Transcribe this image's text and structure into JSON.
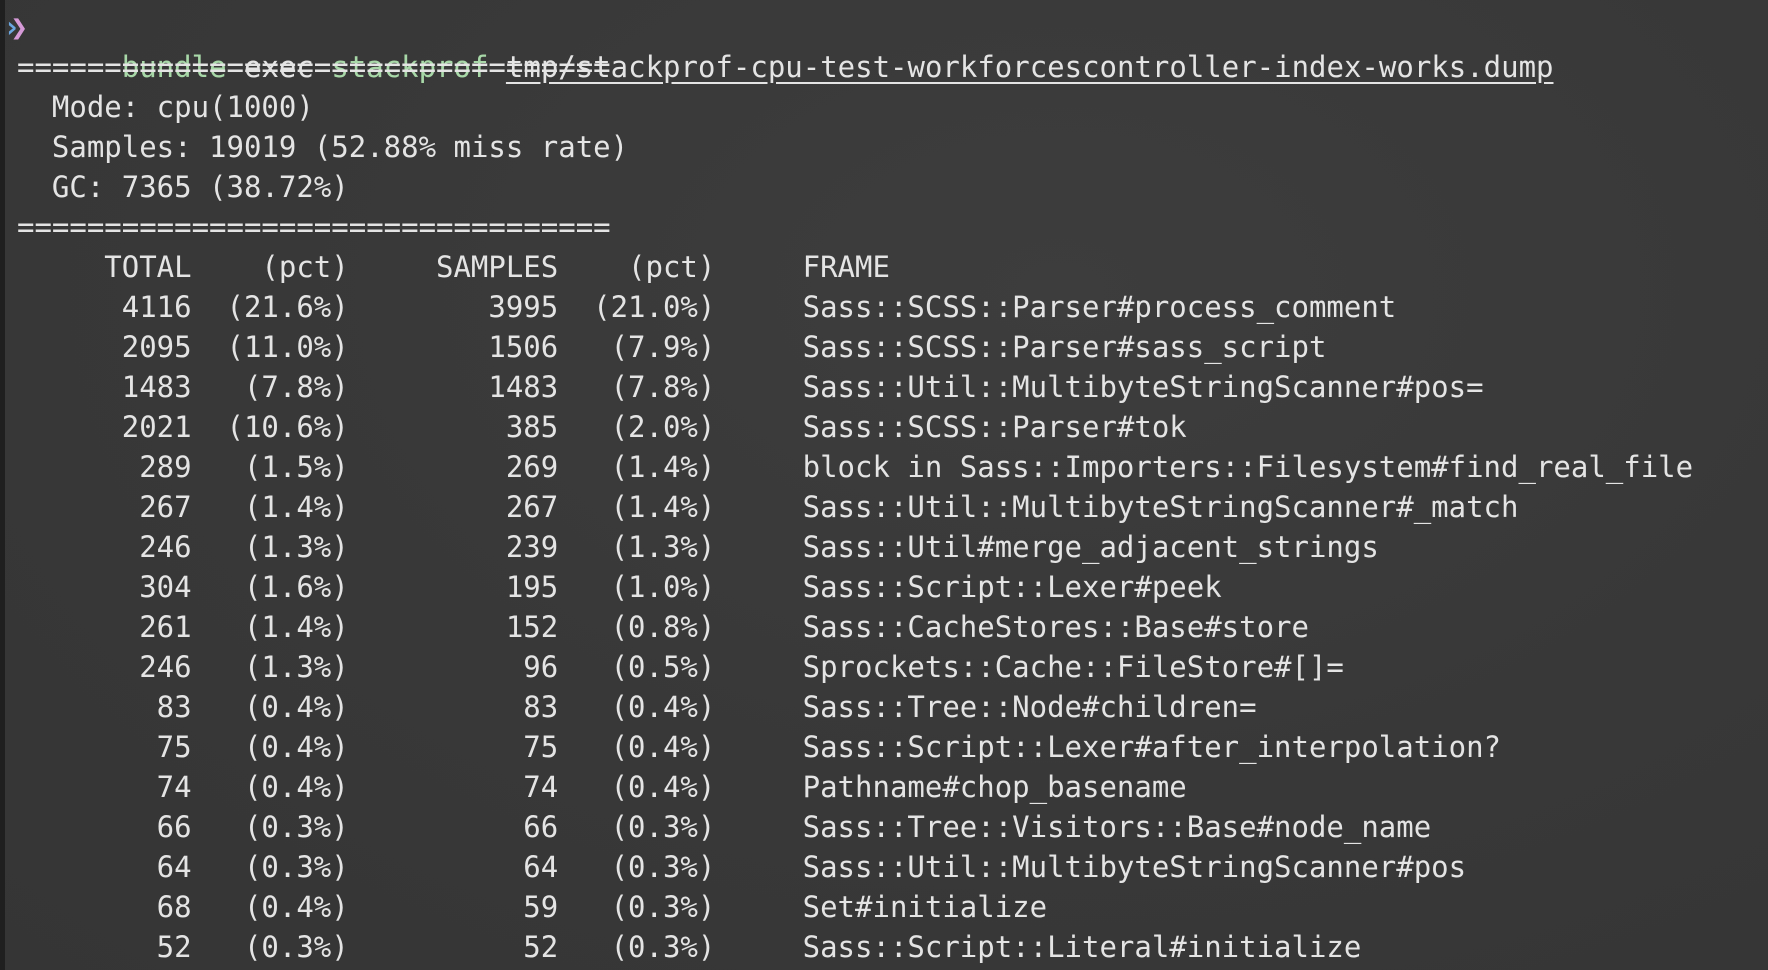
{
  "command": {
    "prompt_icon": "chevron-right-icon",
    "program": "bundle",
    "subcommand": "exec",
    "tool": "stackprof",
    "file": "tmp/stackprof-cpu-test-workforcescontroller-index-works.dump"
  },
  "separator": "==================================",
  "summary": {
    "mode": "Mode: cpu(1000)",
    "samples": "Samples: 19019 (52.88% miss rate)",
    "gc": "GC: 7365 (38.72%)"
  },
  "table": {
    "headers": {
      "total": "TOTAL",
      "pct1": "(pct)",
      "samples": "SAMPLES",
      "pct2": "(pct)",
      "frame": "FRAME"
    },
    "rows": [
      {
        "total": "4116",
        "pct1": "(21.6%)",
        "samples": "3995",
        "pct2": "(21.0%)",
        "frame": "Sass::SCSS::Parser#process_comment"
      },
      {
        "total": "2095",
        "pct1": "(11.0%)",
        "samples": "1506",
        "pct2": "(7.9%)",
        "frame": "Sass::SCSS::Parser#sass_script"
      },
      {
        "total": "1483",
        "pct1": "(7.8%)",
        "samples": "1483",
        "pct2": "(7.8%)",
        "frame": "Sass::Util::MultibyteStringScanner#pos="
      },
      {
        "total": "2021",
        "pct1": "(10.6%)",
        "samples": "385",
        "pct2": "(2.0%)",
        "frame": "Sass::SCSS::Parser#tok"
      },
      {
        "total": "289",
        "pct1": "(1.5%)",
        "samples": "269",
        "pct2": "(1.4%)",
        "frame": "block in Sass::Importers::Filesystem#find_real_file"
      },
      {
        "total": "267",
        "pct1": "(1.4%)",
        "samples": "267",
        "pct2": "(1.4%)",
        "frame": "Sass::Util::MultibyteStringScanner#_match"
      },
      {
        "total": "246",
        "pct1": "(1.3%)",
        "samples": "239",
        "pct2": "(1.3%)",
        "frame": "Sass::Util#merge_adjacent_strings"
      },
      {
        "total": "304",
        "pct1": "(1.6%)",
        "samples": "195",
        "pct2": "(1.0%)",
        "frame": "Sass::Script::Lexer#peek"
      },
      {
        "total": "261",
        "pct1": "(1.4%)",
        "samples": "152",
        "pct2": "(0.8%)",
        "frame": "Sass::CacheStores::Base#store"
      },
      {
        "total": "246",
        "pct1": "(1.3%)",
        "samples": "96",
        "pct2": "(0.5%)",
        "frame": "Sprockets::Cache::FileStore#[]="
      },
      {
        "total": "83",
        "pct1": "(0.4%)",
        "samples": "83",
        "pct2": "(0.4%)",
        "frame": "Sass::Tree::Node#children="
      },
      {
        "total": "75",
        "pct1": "(0.4%)",
        "samples": "75",
        "pct2": "(0.4%)",
        "frame": "Sass::Script::Lexer#after_interpolation?"
      },
      {
        "total": "74",
        "pct1": "(0.4%)",
        "samples": "74",
        "pct2": "(0.4%)",
        "frame": "Pathname#chop_basename"
      },
      {
        "total": "66",
        "pct1": "(0.3%)",
        "samples": "66",
        "pct2": "(0.3%)",
        "frame": "Sass::Tree::Visitors::Base#node_name"
      },
      {
        "total": "64",
        "pct1": "(0.3%)",
        "samples": "64",
        "pct2": "(0.3%)",
        "frame": "Sass::Util::MultibyteStringScanner#pos"
      },
      {
        "total": "68",
        "pct1": "(0.4%)",
        "samples": "59",
        "pct2": "(0.3%)",
        "frame": "Set#initialize"
      },
      {
        "total": "52",
        "pct1": "(0.3%)",
        "samples": "52",
        "pct2": "(0.3%)",
        "frame": "Sass::Script::Literal#initialize"
      }
    ]
  }
}
